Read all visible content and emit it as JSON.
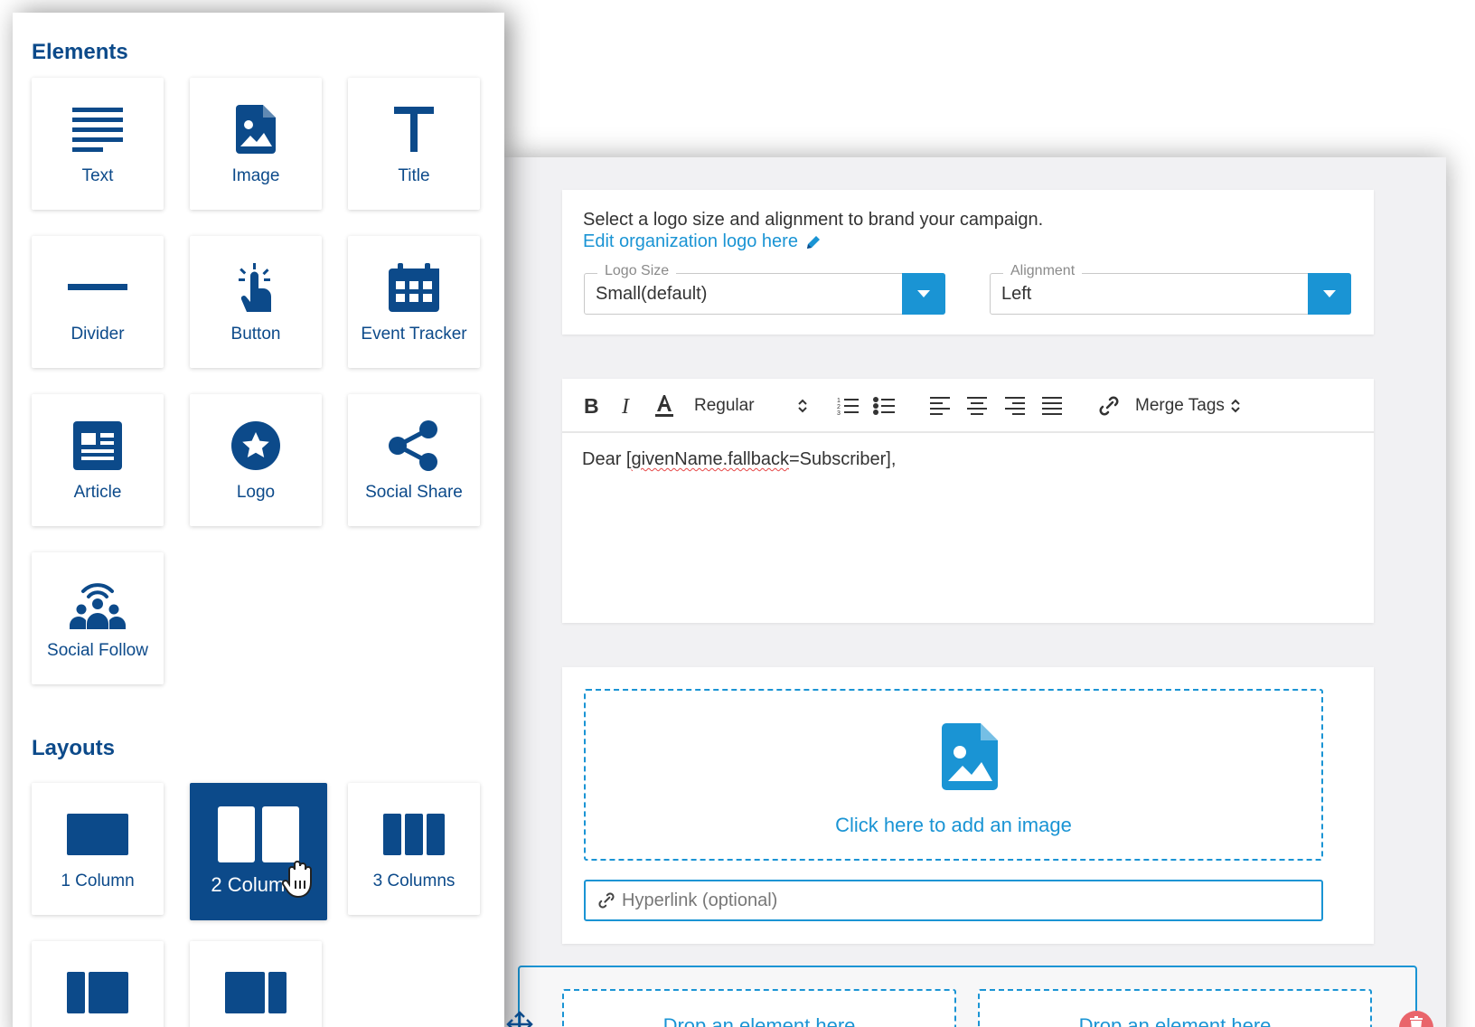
{
  "panel": {
    "elements_title": "Elements",
    "layouts_title": "Layouts",
    "elements": [
      {
        "label": "Text",
        "icon": "text-lines-icon"
      },
      {
        "label": "Image",
        "icon": "image-file-icon"
      },
      {
        "label": "Title",
        "icon": "title-t-icon"
      },
      {
        "label": "Divider",
        "icon": "divider-icon"
      },
      {
        "label": "Button",
        "icon": "tap-finger-icon"
      },
      {
        "label": "Event Tracker",
        "icon": "calendar-icon"
      },
      {
        "label": "Article",
        "icon": "article-icon"
      },
      {
        "label": "Logo",
        "icon": "star-badge-icon"
      },
      {
        "label": "Social Share",
        "icon": "share-icon"
      },
      {
        "label": "Social Follow",
        "icon": "people-broadcast-icon"
      }
    ],
    "layouts": [
      {
        "label": "1 Column",
        "icon": "one-column-icon"
      },
      {
        "label": "2 Columns",
        "icon": "two-columns-icon",
        "active": true
      },
      {
        "label": "3 Columns",
        "icon": "three-columns-icon"
      }
    ]
  },
  "logo_card": {
    "description": "Select a logo size and alignment to brand your campaign.",
    "edit_link": "Edit organization logo here",
    "logo_size": {
      "legend": "Logo Size",
      "value": "Small(default)"
    },
    "alignment": {
      "legend": "Alignment",
      "value": "Left"
    }
  },
  "editor": {
    "font_weight": "Regular",
    "merge_tags": "Merge Tags",
    "body_prefix": "Dear [",
    "body_var": "givenName.fallback",
    "body_suffix": "=Subscriber],"
  },
  "image_card": {
    "add_image": "Click here to add an image",
    "hyperlink_placeholder": "Hyperlink (optional)"
  },
  "columns": {
    "drop_left": "Drop an element here",
    "drop_right": "Drop an element here"
  },
  "colors": {
    "brand": "#0c4a8a",
    "accent": "#1a94d4",
    "danger": "#e9656b"
  }
}
